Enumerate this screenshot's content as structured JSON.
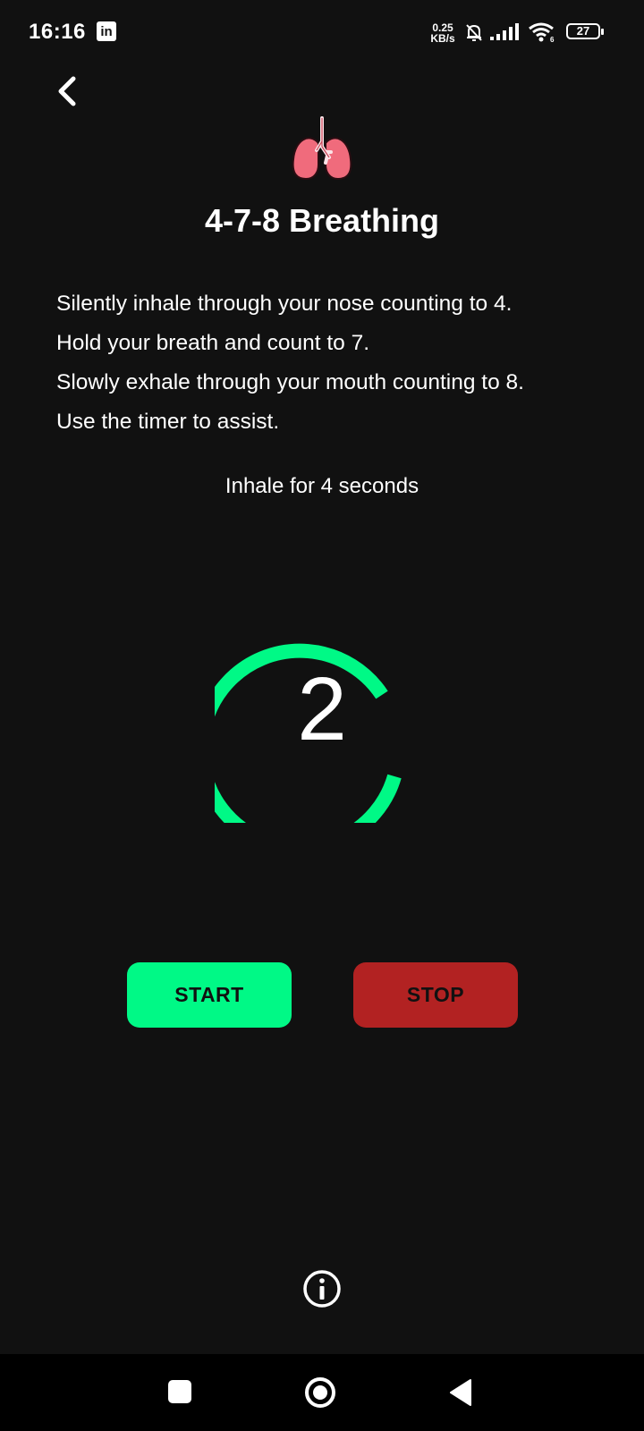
{
  "status_bar": {
    "time": "16:16",
    "app_badge": "in",
    "net_speed_value": "0.25",
    "net_speed_unit": "KB/s",
    "battery_level": "27"
  },
  "header": {
    "title": "4-7-8 Breathing",
    "icon": "lungs-icon"
  },
  "instructions": [
    "Silently inhale through your nose counting to 4.",
    "Hold your breath and count to 7.",
    "Slowly exhale through your mouth counting to 8.",
    "Use the timer to assist."
  ],
  "timer": {
    "phase_label": "Inhale for 4 seconds",
    "count": "2",
    "ring_color": "#00f986"
  },
  "controls": {
    "start_label": "START",
    "stop_label": "STOP",
    "start_color": "#00f986",
    "stop_color": "#b22222"
  },
  "nav_bar": {
    "icons": [
      "recents-icon",
      "home-icon",
      "back-icon"
    ]
  }
}
